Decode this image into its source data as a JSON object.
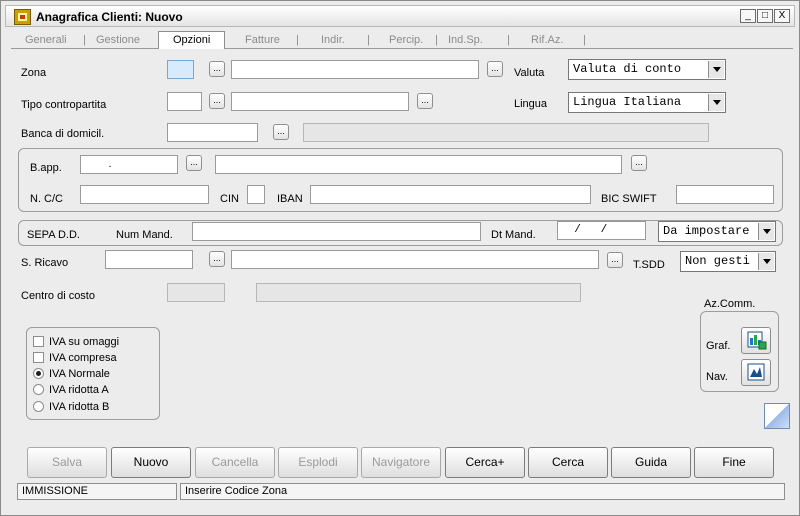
{
  "window": {
    "title": "Anagrafica Clienti: Nuovo",
    "controls": [
      "_",
      "□",
      "X"
    ]
  },
  "tabs": [
    {
      "label": "Generali",
      "active": false
    },
    {
      "label": "Gestione",
      "active": false
    },
    {
      "label": "Opzioni",
      "active": true
    },
    {
      "label": "Fatture",
      "active": false
    },
    {
      "label": "Indir.",
      "active": false
    },
    {
      "label": "Percip.",
      "active": false
    },
    {
      "label": "Ind.Sp.",
      "active": false
    },
    {
      "label": "Rif.Az.",
      "active": false
    }
  ],
  "separator": "|",
  "fields": {
    "zona": {
      "label": "Zona",
      "code": "",
      "desc": ""
    },
    "tipo_contropartita": {
      "label": "Tipo contropartita",
      "code": "",
      "desc": ""
    },
    "banca": {
      "label": "Banca di domicil.",
      "code": "",
      "desc": ""
    },
    "valuta": {
      "label": "Valuta",
      "value": "Valuta di conto"
    },
    "lingua": {
      "label": "Lingua",
      "value": "Lingua Italiana"
    },
    "bapp": {
      "label": "B.app.",
      "code": "        .",
      "desc": ""
    },
    "ncc": {
      "label": "N. C/C",
      "value": ""
    },
    "cin": {
      "label": "CIN",
      "value": ""
    },
    "iban": {
      "label": "IBAN",
      "value": ""
    },
    "bic": {
      "label": "BIC SWIFT",
      "value": ""
    },
    "sepa": {
      "label": "SEPA D.D."
    },
    "num_mand": {
      "label": "Num Mand.",
      "value": ""
    },
    "dt_mand": {
      "label": "Dt Mand.",
      "value": "  /   /"
    },
    "sepa_stato": {
      "value": "Da impostare"
    },
    "s_ricavo": {
      "label": "S. Ricavo",
      "code": "",
      "desc": ""
    },
    "tsdd": {
      "label": "T.SDD",
      "value": "Non gesti"
    },
    "centro_costo": {
      "label": "Centro di costo",
      "code": "",
      "desc": ""
    }
  },
  "iva": {
    "options": [
      {
        "label": "IVA su omaggi",
        "type": "checkbox",
        "checked": false
      },
      {
        "label": "IVA compresa",
        "type": "checkbox",
        "checked": false
      },
      {
        "label": "IVA Normale",
        "type": "radio",
        "checked": true
      },
      {
        "label": "IVA ridotta A",
        "type": "radio",
        "checked": false
      },
      {
        "label": "IVA ridotta B",
        "type": "radio",
        "checked": false
      }
    ]
  },
  "azcomm": {
    "label": "Az.Comm.",
    "graf": "Graf.",
    "nav": "Nav."
  },
  "buttons": {
    "salva": "Salva",
    "nuovo": "Nuovo",
    "cancella": "Cancella",
    "esplodi": "Esplodi",
    "navigatore": "Navigatore",
    "cerca_plus": "Cerca+",
    "cerca": "Cerca",
    "guida": "Guida",
    "fine": "Fine"
  },
  "status": {
    "mode": "IMMISSIONE",
    "message": "Inserire Codice Zona"
  },
  "dots": "..."
}
